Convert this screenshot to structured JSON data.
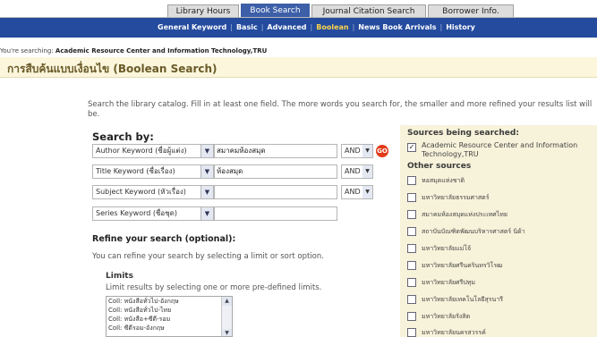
{
  "tabs": [
    {
      "label": "Library Hours"
    },
    {
      "label": "Book Search"
    },
    {
      "label": "Journal Citation Search"
    },
    {
      "label": "Borrower Info."
    }
  ],
  "nav": {
    "links": [
      "General Keyword",
      "Basic",
      "Advanced",
      "Boolean",
      "News Book Arrivals",
      "History"
    ],
    "active": "Boolean"
  },
  "searching": {
    "prefix": "You're searching:",
    "name": "Academic Resource Center and Information Technology,TRU"
  },
  "page_title": "การสืบค้นแบบเงื่อนไข (Boolean Search)",
  "intro": "Search the library catalog. Fill in at least one field. The more words you search for, the smaller and more refined your results list will be.",
  "search_by": "Search by:",
  "rows": [
    {
      "field": "Author Keyword (ชื่อผู้แต่ง)",
      "value": "สมาคมห้องสมุด",
      "op": "AND"
    },
    {
      "field": "Title Keyword (ชื่อเรื่อง)",
      "value": "ห้องสมุด",
      "op": "AND"
    },
    {
      "field": "Subject Keyword (หัวเรื่อง)",
      "value": "",
      "op": "AND"
    },
    {
      "field": "Series Keyword (ชื่อชุด)",
      "value": "",
      "op": ""
    }
  ],
  "go_label": "GO",
  "refine": {
    "heading": "Refine your search (optional):",
    "text": "You can refine your search by selecting a limit or sort option."
  },
  "limits": {
    "heading": "Limits",
    "text": "Limit results by selecting one or more pre-defined limits.",
    "options": [
      "Coll: หนังสือทั่วไป-อังกฤษ",
      "Coll: หนังสือทั่วไป-ไทย",
      "Coll: หนังสือ+ซีดี-รอม",
      "Coll: ซีดีรอม-อังกฤษ"
    ]
  },
  "sources": {
    "heading": "Sources being searched:",
    "main_label": "Academic Resource Center and Information Technology,TRU",
    "other_heading": "Other sources",
    "others": [
      "หอสมุดแห่งชาติ",
      "มหาวิทยาลัยธรรมศาสตร์",
      "สมาคมห้องสมุดแห่งประเทศไทย",
      "สถาบันบัณฑิตพัฒนบริหารศาสตร์ นิด้า",
      "มหาวิทยาลัยแม่โจ้",
      "มหาวิทยาลัยศรีนครินทรวิโรฒ",
      "มหาวิทยาลัยศรีปทุม",
      "มหาวิทยาลัยเทคโนโลยีสุรนารี",
      "มหาวิทยาลัยรังสิต",
      "มหาวิทยาลัยนครสวรรค์"
    ]
  },
  "colors": {
    "nav_bg": "#244b9e",
    "active_tab": "#3c5fa8",
    "title_bg": "#fbf6dc",
    "sources_bg": "#f7f2da",
    "go_button": "#e23b1a",
    "active_nav_link": "#ffd54a"
  }
}
